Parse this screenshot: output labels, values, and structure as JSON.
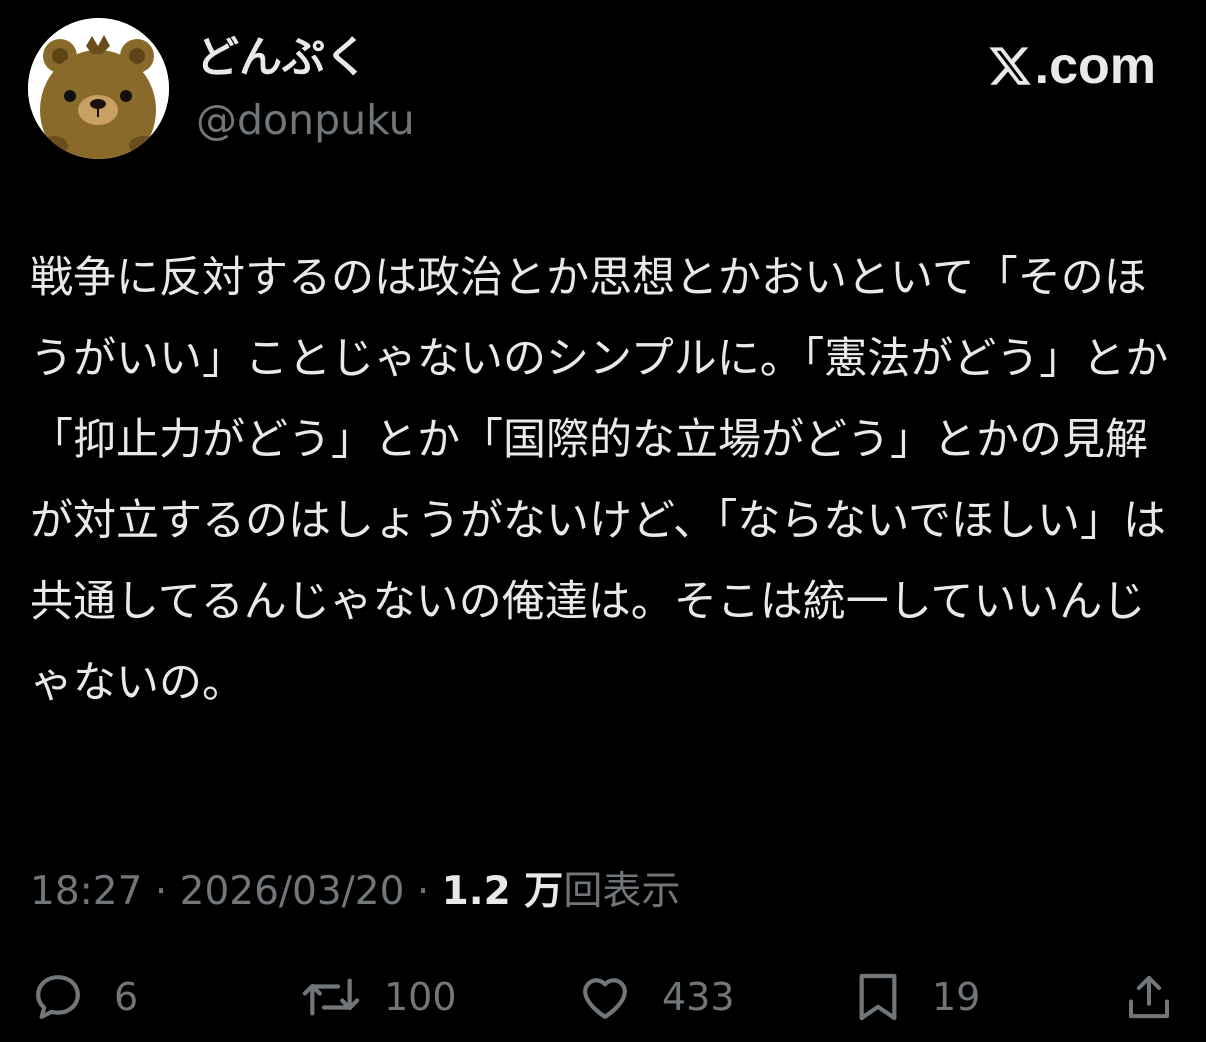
{
  "header": {
    "display_name": "どんぷく",
    "handle": "@donpuku",
    "brand": ".com",
    "brand_icon": "x-logo-icon"
  },
  "avatar": {
    "icon": "bear-avatar",
    "colors": {
      "face": "#8a6a2b",
      "snout": "#c9a064",
      "background": "#ffffff"
    }
  },
  "tweet": {
    "text": "戦争に反対するのは政治とか思想とかおいといて「そのほうがいい」ことじゃないのシンプルに。「憲法がどう」とか「抑止力がどう」とか「国際的な立場がどう」とかの見解が対立するのはしょうがないけど、「ならないでほしい」は共通してるんじゃないの俺達は。そこは統一していいんじゃないの。"
  },
  "meta": {
    "time": "18:27",
    "separator": "·",
    "date": "2026/03/20",
    "views_count": "1.2 万",
    "views_label": "回表示"
  },
  "actions": {
    "reply": {
      "icon": "reply-icon",
      "count": "6"
    },
    "repost": {
      "icon": "repost-icon",
      "count": "100"
    },
    "like": {
      "icon": "heart-icon",
      "count": "433"
    },
    "bookmark": {
      "icon": "bookmark-icon",
      "count": "19"
    },
    "share": {
      "icon": "share-icon"
    }
  },
  "colors": {
    "background": "#000000",
    "text_primary": "#e7e9ea",
    "text_secondary": "#71767b"
  }
}
